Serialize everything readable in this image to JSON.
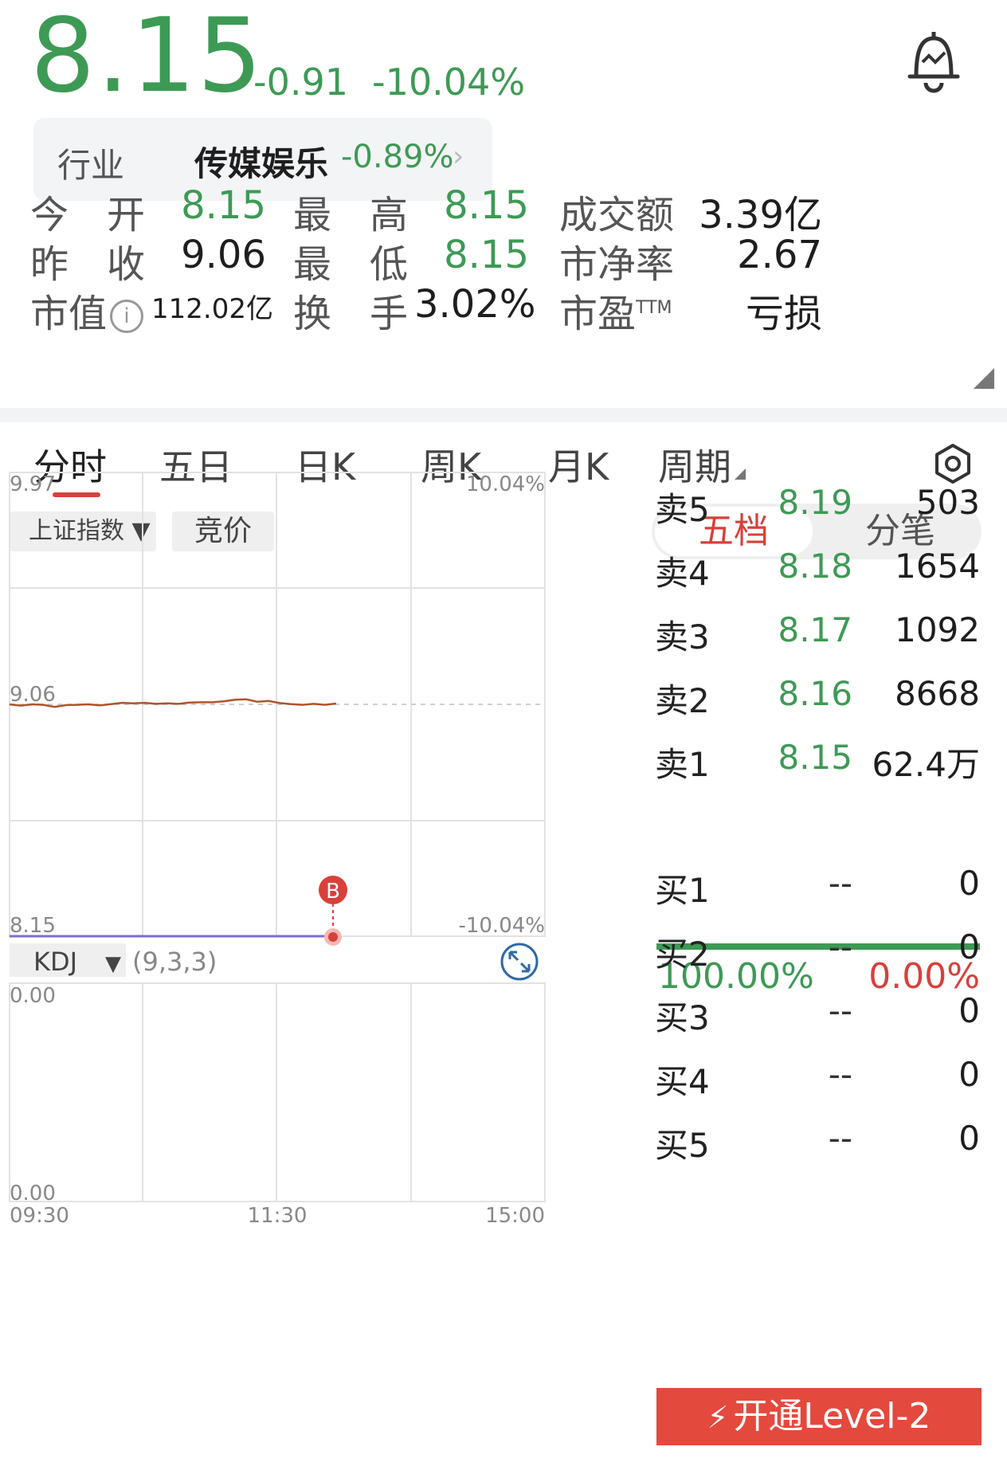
{
  "header": {
    "price": "8.15",
    "change": "-0.91",
    "change_pct": "-10.04%",
    "bell_icon": "bell-alert-icon"
  },
  "industry": {
    "label": "行业",
    "name": "传媒娱乐",
    "pct": "-0.89%",
    "chevron": "›"
  },
  "stats": {
    "open_label": "今　开",
    "open": "8.15",
    "high_label": "最　高",
    "high": "8.15",
    "turnover_amt_label": "成交额",
    "turnover_amt": "3.39亿",
    "prev_close_label": "昨　收",
    "prev_close": "9.06",
    "low_label": "最　低",
    "low": "8.15",
    "pb_label": "市净率",
    "pb": "2.67",
    "mktcap_label": "市值",
    "info_icon": "ⓘ",
    "mktcap": "112.02亿",
    "turnover_rate_label": "换　手",
    "turnover_rate": "3.02%",
    "pe_label": "市盈",
    "pe_sup": "TTM",
    "pe": "亏损"
  },
  "tabs": [
    "分时",
    "五日",
    "日K",
    "周K",
    "月K",
    "周期"
  ],
  "chart_controls": {
    "index_select": "上证指数 ▼",
    "auction": "竞价",
    "indicator_select": "KDJ",
    "indicator_arrow": "▼",
    "indicator_params": "(9,3,3)"
  },
  "chart_data": {
    "type": "line",
    "y_left_ticks": [
      "9.97",
      "9.06",
      "8.15"
    ],
    "y_right_ticks": [
      "10.04%",
      "-10.04%"
    ],
    "x_ticks": [
      "09:30",
      "11:30",
      "15:00"
    ],
    "ylim": [
      8.15,
      9.97
    ],
    "reference_price": 9.06,
    "series": [
      {
        "values": [
          9.06,
          9.055,
          9.06,
          9.058,
          9.05,
          9.057,
          9.058,
          9.06,
          9.056,
          9.061,
          9.066,
          9.064,
          9.066,
          9.062,
          9.064,
          9.062,
          9.067,
          9.068,
          9.068,
          9.072,
          9.078,
          9.08,
          9.07,
          9.073,
          9.065,
          9.061,
          9.058,
          9.062,
          9.058,
          9.063
        ]
      },
      {
        "values": [
          8.15,
          8.15,
          8.15,
          8.15,
          8.15,
          8.15,
          8.15,
          8.15,
          8.15,
          8.15
        ]
      }
    ],
    "marker": {
      "label": "B",
      "time_fraction": 0.61,
      "price": 8.15
    },
    "kdj": {
      "ylim_labels": [
        "0.00",
        "0.00"
      ]
    }
  },
  "order_book": {
    "tab_five": "五档",
    "tab_ticks": "分笔",
    "asks": [
      {
        "label": "卖5",
        "price": "8.19",
        "vol": "503"
      },
      {
        "label": "卖4",
        "price": "8.18",
        "vol": "1654"
      },
      {
        "label": "卖3",
        "price": "8.17",
        "vol": "1092"
      },
      {
        "label": "卖2",
        "price": "8.16",
        "vol": "8668"
      },
      {
        "label": "卖1",
        "price": "8.15",
        "vol": "62.4万"
      }
    ],
    "buy_ratio": "100.00%",
    "sell_ratio": "0.00%",
    "bids": [
      {
        "label": "买1",
        "price": "--",
        "vol": "0"
      },
      {
        "label": "买2",
        "price": "--",
        "vol": "0"
      },
      {
        "label": "买3",
        "price": "--",
        "vol": "0"
      },
      {
        "label": "买4",
        "price": "--",
        "vol": "0"
      },
      {
        "label": "买5",
        "price": "--",
        "vol": "0"
      }
    ]
  },
  "level2_button": "开通Level-2",
  "colors": {
    "up": "#d8403a",
    "down": "#3d9a55",
    "price_line": "#b0542c",
    "limit_line": "#7b6fd0"
  }
}
